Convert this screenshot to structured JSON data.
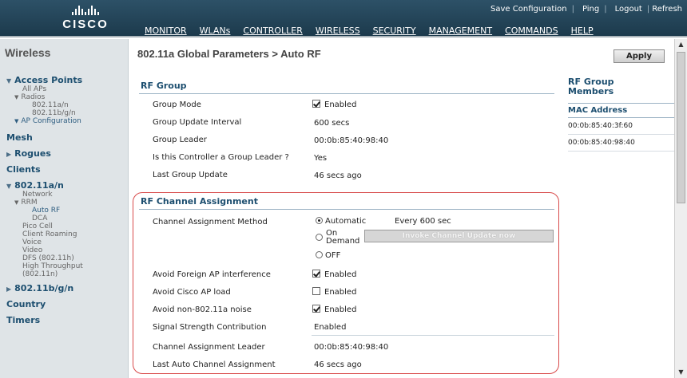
{
  "header": {
    "logo_text": "CISCO",
    "util_links": [
      "Save Configuration",
      "Ping",
      "Logout",
      "Refresh"
    ],
    "nav": [
      "MONITOR",
      "WLANs",
      "CONTROLLER",
      "WIRELESS",
      "SECURITY",
      "MANAGEMENT",
      "COMMANDS",
      "HELP"
    ],
    "active_nav": "WIRELESS"
  },
  "sidebar": {
    "title": "Wireless",
    "access_points": "Access Points",
    "all_aps": "All APs",
    "radios": "Radios",
    "radio_a": "802.11a/n",
    "radio_bg": "802.11b/g/n",
    "ap_config": "AP Configuration",
    "mesh": "Mesh",
    "rogues": "Rogues",
    "clients": "Clients",
    "a_section": "802.11a/n",
    "network": "Network",
    "rrm": "RRM",
    "auto_rf": "Auto RF",
    "dca": "DCA",
    "pico": "Pico Cell",
    "roaming": "Client Roaming",
    "voice": "Voice",
    "video": "Video",
    "dfs": "DFS (802.11h)",
    "ht1": "High Throughput",
    "ht2": "(802.11n)",
    "bg_section": "802.11b/g/n",
    "country": "Country",
    "timers": "Timers"
  },
  "main": {
    "page_title": "802.11a Global Parameters > Auto RF",
    "apply": "Apply",
    "rf_group": {
      "heading": "RF Group",
      "group_mode_label": "Group Mode",
      "group_mode_value": "Enabled",
      "update_interval_label": "Group Update Interval",
      "update_interval_value": "600 secs",
      "leader_label": "Group Leader",
      "leader_value": "00:0b:85:40:98:40",
      "is_leader_label": "Is this Controller a Group Leader ?",
      "is_leader_value": "Yes",
      "last_update_label": "Last Group Update",
      "last_update_value": "46 secs ago"
    },
    "channel": {
      "heading": "RF Channel Assignment",
      "method_label": "Channel Assignment Method",
      "opt_auto": "Automatic",
      "every": "Every 600 sec",
      "opt_on": "On",
      "opt_demand": "Demand",
      "invoke": "Invoke Channel Update now",
      "opt_off": "OFF",
      "foreign_label": "Avoid Foreign AP interference",
      "foreign_value": "Enabled",
      "cisco_label": "Avoid Cisco AP load",
      "cisco_value": "Enabled",
      "noise_label": "Avoid non-802.11a noise",
      "noise_value": "Enabled",
      "signal_label": "Signal Strength Contribution",
      "signal_value": "Enabled",
      "leader_label": "Channel Assignment Leader",
      "leader_value": "00:0b:85:40:98:40",
      "last_label": "Last Auto Channel Assignment",
      "last_value": "46 secs ago"
    },
    "members": {
      "title1": "RF Group",
      "title2": "Members",
      "col": "MAC Address",
      "rows": [
        "00:0b:85:40:3f:60",
        "00:0b:85:40:98:40"
      ]
    }
  }
}
